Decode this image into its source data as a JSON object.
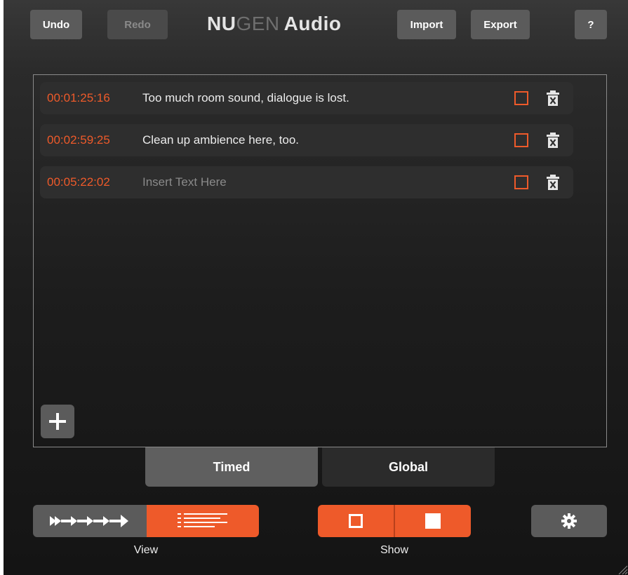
{
  "toolbar": {
    "undo_label": "Undo",
    "redo_label": "Redo",
    "logo_nu": "NU",
    "logo_gen": "GEN",
    "logo_audio": "Audio",
    "import_label": "Import",
    "export_label": "Export",
    "help_label": "?"
  },
  "notes": [
    {
      "timecode": "00:01:25:16",
      "text": "Too much room sound, dialogue is lost.",
      "placeholder": false
    },
    {
      "timecode": "00:02:59:25",
      "text": "Clean up ambience here, too.",
      "placeholder": false
    },
    {
      "timecode": "00:05:22:02",
      "text": "Insert Text Here",
      "placeholder": true
    }
  ],
  "tabs": {
    "timed_label": "Timed",
    "global_label": "Global",
    "active": "Timed"
  },
  "bottom": {
    "view_label": "View",
    "show_label": "Show",
    "view_active": "list",
    "show_active": "both"
  },
  "icons": {
    "delete": "trash-x-icon",
    "add": "plus-icon",
    "settings": "gear-icon",
    "timeline": "fast-forward-arrows-icon",
    "list": "list-lines-icon",
    "show_empty": "empty-square-icon",
    "show_filled": "filled-square-icon"
  },
  "colors": {
    "accent": "#ee5a2a",
    "background": "#1c1c1c",
    "button": "#5b5b5b",
    "row": "#2e2e2e"
  }
}
